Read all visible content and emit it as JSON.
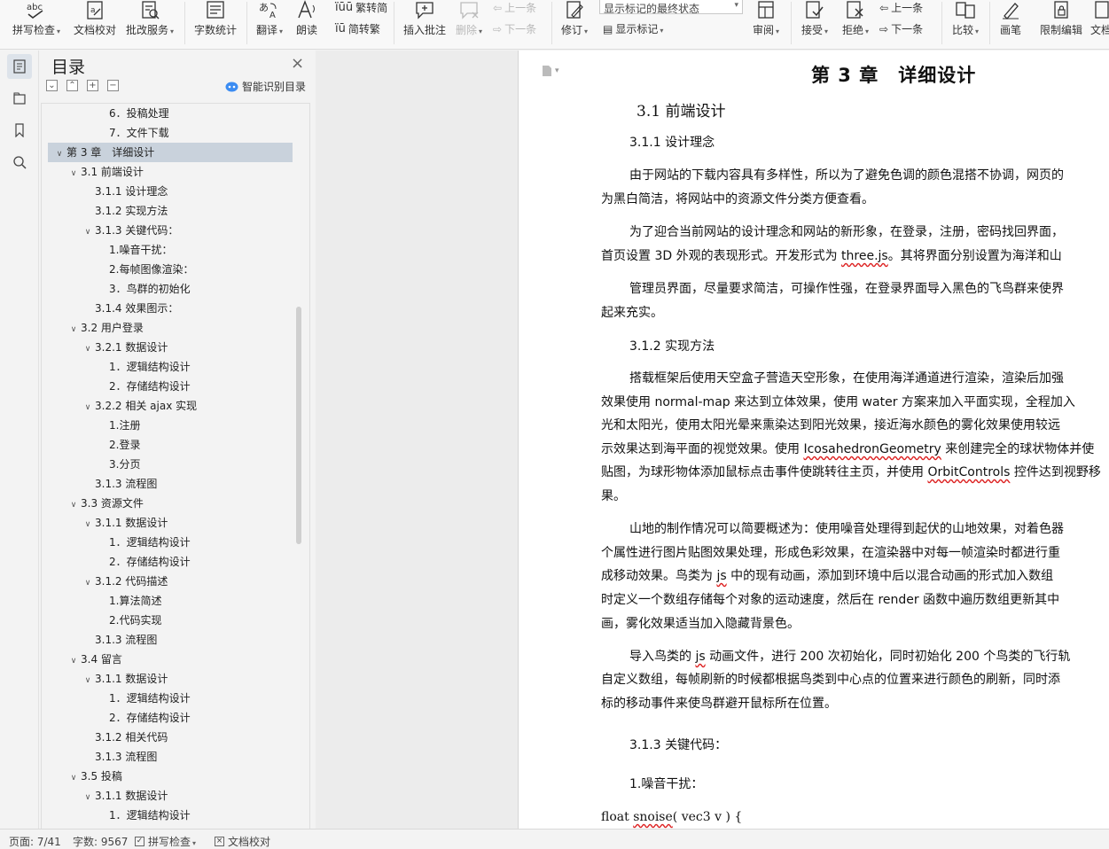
{
  "ribbon": {
    "spell_check": "拼写检查",
    "doc_proof": "文档校对",
    "review_service": "批改服务",
    "word_count": "字数统计",
    "translate": "翻译",
    "read_aloud": "朗读",
    "trad_to_simp": "繁转简",
    "simp_to_trad": "简转繁",
    "insert_comment": "插入批注",
    "delete": "删除",
    "prev_comment": "上一条",
    "next_comment": "下一条",
    "track_changes": "修订",
    "markup_state": "显示标记的最终状态",
    "show_markup": "显示标记",
    "review": "审阅",
    "accept": "接受",
    "reject": "拒绝",
    "prev_change": "上一条",
    "next_change": "下一条",
    "compare": "比较",
    "pen": "画笔",
    "restrict_edit": "限制编辑",
    "doc_more": "文档"
  },
  "toc": {
    "title": "目录",
    "smart_label": "智能识别目录",
    "items": [
      {
        "text": "6．投稿处理",
        "level": 3,
        "arrow": ""
      },
      {
        "text": "7．文件下载",
        "level": 3,
        "arrow": ""
      },
      {
        "text": "第 3 章　详细设计",
        "level": 0,
        "arrow": "open",
        "selected": true
      },
      {
        "text": "3.1 前端设计",
        "level": 1,
        "arrow": "open"
      },
      {
        "text": "3.1.1 设计理念",
        "level": 2,
        "arrow": ""
      },
      {
        "text": "3.1.2 实现方法",
        "level": 2,
        "arrow": ""
      },
      {
        "text": "3.1.3 关键代码：",
        "level": 2,
        "arrow": "open"
      },
      {
        "text": "1.噪音干扰：",
        "level": 3,
        "arrow": ""
      },
      {
        "text": "2.每帧图像渲染：",
        "level": 3,
        "arrow": ""
      },
      {
        "text": "3．鸟群的初始化",
        "level": 3,
        "arrow": ""
      },
      {
        "text": "3.1.4 效果图示：",
        "level": 2,
        "arrow": ""
      },
      {
        "text": "3.2 用户登录",
        "level": 1,
        "arrow": "open"
      },
      {
        "text": "3.2.1 数据设计",
        "level": 2,
        "arrow": "open"
      },
      {
        "text": "1．逻辑结构设计",
        "level": 3,
        "arrow": ""
      },
      {
        "text": "2．存储结构设计",
        "level": 3,
        "arrow": ""
      },
      {
        "text": "3.2.2 相关 ajax 实现",
        "level": 2,
        "arrow": "open"
      },
      {
        "text": "1.注册",
        "level": 3,
        "arrow": ""
      },
      {
        "text": "2.登录",
        "level": 3,
        "arrow": ""
      },
      {
        "text": "3.分页",
        "level": 3,
        "arrow": ""
      },
      {
        "text": "3.1.3 流程图",
        "level": 2,
        "arrow": ""
      },
      {
        "text": "3.3 资源文件",
        "level": 1,
        "arrow": "open"
      },
      {
        "text": "3.1.1 数据设计",
        "level": 2,
        "arrow": "open"
      },
      {
        "text": "1．逻辑结构设计",
        "level": 3,
        "arrow": ""
      },
      {
        "text": "2．存储结构设计",
        "level": 3,
        "arrow": ""
      },
      {
        "text": "3.1.2 代码描述",
        "level": 2,
        "arrow": "open"
      },
      {
        "text": "1.算法简述",
        "level": 3,
        "arrow": ""
      },
      {
        "text": "2.代码实现",
        "level": 3,
        "arrow": ""
      },
      {
        "text": "3.1.3 流程图",
        "level": 2,
        "arrow": ""
      },
      {
        "text": "3.4 留言",
        "level": 1,
        "arrow": "open"
      },
      {
        "text": "3.1.1 数据设计",
        "level": 2,
        "arrow": "open"
      },
      {
        "text": "1．逻辑结构设计",
        "level": 3,
        "arrow": ""
      },
      {
        "text": "2．存储结构设计",
        "level": 3,
        "arrow": ""
      },
      {
        "text": "3.1.2 相关代码",
        "level": 2,
        "arrow": ""
      },
      {
        "text": "3.1.3 流程图",
        "level": 2,
        "arrow": ""
      },
      {
        "text": "3.5 投稿",
        "level": 1,
        "arrow": "open"
      },
      {
        "text": "3.1.1 数据设计",
        "level": 2,
        "arrow": "open"
      },
      {
        "text": "1．逻辑结构设计",
        "level": 3,
        "arrow": ""
      }
    ]
  },
  "doc": {
    "chapter": "第 3 章　详细设计",
    "s31": "3.1 前端设计",
    "s311": "3.1.1 设计理念",
    "p1a": "由于网站的下载内容具有多样性，所以为了避免色调的颜色混搭不协调，网页的",
    "p1b": "为黑白简洁，将网站中的资源文件分类方便查看。",
    "p2a": "为了迎合当前网站的设计理念和网站的新形象，在登录，注册，密码找回界面，",
    "p2b_1": "首页设置 3D 外观的表现形式。开发形式为 ",
    "p2b_wavy": "three.js",
    "p2b_2": "。其将界面分别设置为海洋和山",
    "p3a": "管理员界面，尽量要求简洁，可操作性强，在登录界面导入黑色的飞鸟群来使界",
    "p3b": "起来充实。",
    "s312": "3.1.2 实现方法",
    "p4a": "搭载框架后使用天空盒子营造天空形象，在使用海洋通道进行渲染，渲染后加强",
    "p4b": "效果使用 normal-map 来达到立体效果，使用 water 方案来加入平面实现，全程加入",
    "p4c": "光和太阳光，使用太阳光晕来熏染达到阳光效果，接近海水颜色的雾化效果使用较远",
    "p4d_1": "示效果达到海平面的视觉效果。使用 ",
    "p4d_wavy": "IcosahedronGeometry",
    "p4d_2": " 来创建完全的球状物体并使",
    "p4e_1": "贴图，为球形物体添加鼠标点击事件使跳转往主页，并使用 ",
    "p4e_wavy": "OrbitControls",
    "p4e_2": " 控件达到视野移",
    "p4f": "果。",
    "p5a": "山地的制作情况可以简要概述为：使用噪音处理得到起伏的山地效果，对着色器",
    "p5b": "个属性进行图片贴图效果处理，形成色彩效果，在渲染器中对每一帧渲染时都进行重",
    "p5c_1": "成移动效果。鸟类为 ",
    "p5c_wavy": "js",
    "p5c_2": " 中的现有动画，添加到环境中后以混合动画的形式加入数组",
    "p5d": "时定义一个数组存储每个对象的运动速度，然后在 render 函数中遍历数组更新其中",
    "p5e": "画，雾化效果适当加入隐藏背景色。",
    "p6a_1": "导入鸟类的 ",
    "p6a_wavy": "js",
    "p6a_2": " 动画文件，进行 200 次初始化，同时初始化 200 个鸟类的飞行轨",
    "p6b": "自定义数组，每帧刷新的时候都根据鸟类到中心点的位置来进行颜色的刷新，同时添",
    "p6c": "标的移动事件来使鸟群避开鼠标所在位置。",
    "s313": "3.1.3 关键代码：",
    "s_noise": "1.噪音干扰：",
    "code_1": "float ",
    "code_wavy": "snoise",
    "code_2": "( vec3 v ) {"
  },
  "status": {
    "page": "页面: 7/41",
    "words": "字数: 9567",
    "spell": "拼写检查",
    "proof": "文档校对"
  }
}
